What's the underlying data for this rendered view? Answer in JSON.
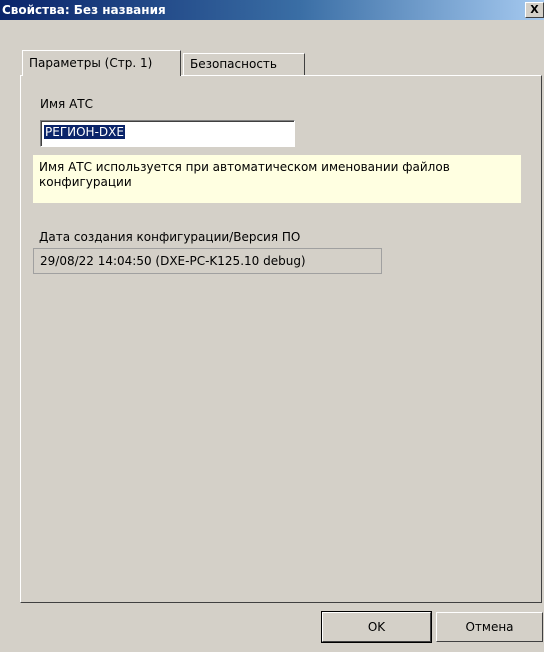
{
  "window": {
    "title": "Свойства: Без названия",
    "close_glyph": "X",
    "close_icon": "close-icon"
  },
  "tabs": [
    {
      "label": "Параметры (Стр. 1)",
      "active": true
    },
    {
      "label": "Безопасность",
      "active": false
    }
  ],
  "pbx": {
    "name_label": "Имя АТС",
    "name_value": "РЕГИОН-DXE",
    "hint": "Имя АТС используется при автоматическом именовании файлов конфигурации",
    "version_label": "Дата создания конфигурации/Версия ПО",
    "version_value": "29/08/22 14:04:50 (DXE-PC-K125.10 debug)"
  },
  "buttons": {
    "ok": "OK",
    "cancel": "Отмена"
  },
  "colors": {
    "title_bar": "#0a246a",
    "dialog_bg": "#d4d0c8",
    "hint_bg": "#ffffe1",
    "selection": "#0a246a"
  }
}
